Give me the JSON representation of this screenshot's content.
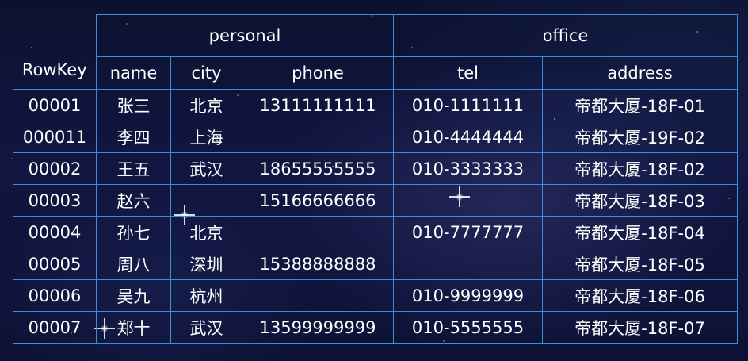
{
  "table": {
    "rowkey_header": "RowKey",
    "groups": [
      {
        "label": "personal"
      },
      {
        "label": "office"
      }
    ],
    "columns": [
      "name",
      "city",
      "phone",
      "tel",
      "address"
    ],
    "rows": [
      {
        "rowkey": "00001",
        "name": "张三",
        "city": "北京",
        "phone": "13111111111",
        "tel": "010-1111111",
        "address": "帝都大厦-18F-01"
      },
      {
        "rowkey": "000011",
        "name": "李四",
        "city": "上海",
        "phone": "",
        "tel": "010-4444444",
        "address": "帝都大厦-19F-02"
      },
      {
        "rowkey": "00002",
        "name": "王五",
        "city": "武汉",
        "phone": "18655555555",
        "tel": "010-3333333",
        "address": "帝都大厦-18F-02"
      },
      {
        "rowkey": "00003",
        "name": "赵六",
        "city": "",
        "phone": "15166666666",
        "tel": "",
        "address": "帝都大厦-18F-03"
      },
      {
        "rowkey": "00004",
        "name": "孙七",
        "city": "北京",
        "phone": "",
        "tel": "010-7777777",
        "address": "帝都大厦-18F-04"
      },
      {
        "rowkey": "00005",
        "name": "周八",
        "city": "深圳",
        "phone": "15388888888",
        "tel": "",
        "address": "帝都大厦-18F-05"
      },
      {
        "rowkey": "00006",
        "name": "吴九",
        "city": "杭州",
        "phone": "",
        "tel": "010-9999999",
        "address": "帝都大厦-18F-06"
      },
      {
        "rowkey": "00007",
        "name": "郑十",
        "city": "武汉",
        "phone": "13599999999",
        "tel": "010-5555555",
        "address": "帝都大厦-18F-07"
      }
    ]
  },
  "colors": {
    "grid_line": "#3a8fd6",
    "text": "#ffffff",
    "background": "#0b1230"
  }
}
